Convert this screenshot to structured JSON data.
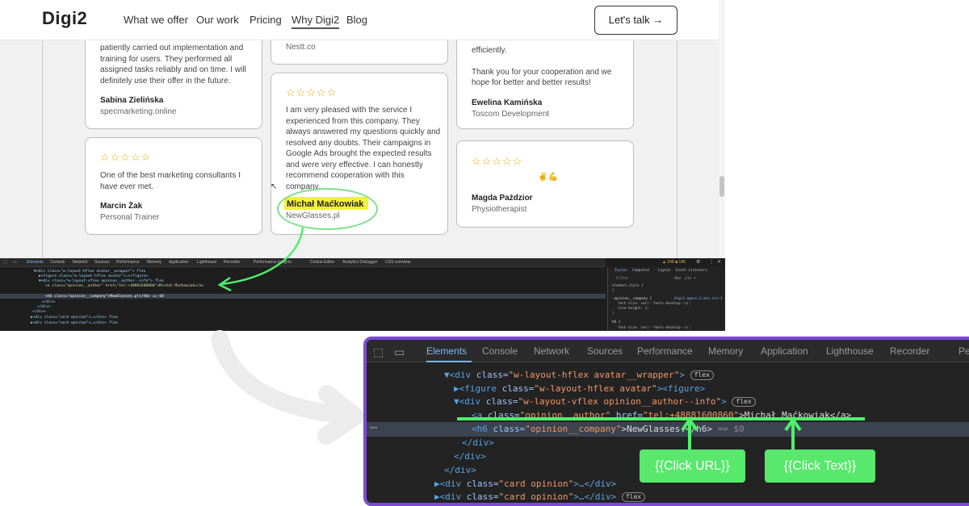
{
  "site": {
    "logo": "Digi2",
    "nav": [
      "What we offer",
      "Our work",
      "Pricing",
      "Why Digi2",
      "Blog"
    ],
    "cta": "Let's talk →"
  },
  "testimonials": [
    {
      "stars": "☆☆☆☆☆",
      "text_lines": [
        "patiently carried out implementation and",
        "training for users. They performed all",
        "assigned tasks reliably and on time. I will",
        "definitely use their offer in the future."
      ],
      "name": "Sabina Zielińska",
      "company": "specmarketing.online"
    },
    {
      "stars": "☆☆☆☆☆",
      "text_lines": [
        "One of the best marketing consultants I",
        "have ever met."
      ],
      "name": "Marcin Żak",
      "company": "Personal Trainer"
    },
    {
      "stars": "",
      "text_lines": [],
      "name": "",
      "company": "Nestt.co"
    },
    {
      "stars": "☆☆☆☆☆",
      "text_lines": [
        "I am very pleased with the service I",
        "experienced from this company. They",
        "always answered my questions quickly and",
        "resolved any doubts. Their campaigns in",
        "Google Ads brought the expected results",
        "and were very effective. I can honestly",
        "recommend cooperation with this",
        "company."
      ],
      "name": "Michał Maćkowiak",
      "company": "NewGlasses.pl"
    },
    {
      "stars": "",
      "text_lines": [
        "efficiently.",
        "",
        "Thank you for your cooperation and we",
        "hope for better and better results!"
      ],
      "name": "Ewelina Kamińska",
      "company": "Toscom Development"
    },
    {
      "stars": "☆☆☆☆☆",
      "text_lines": [
        "✌💪"
      ],
      "name": "Magda Paździor",
      "company": "Physiotherapist"
    }
  ],
  "devtools_small": {
    "tabs": [
      "Elements",
      "Console",
      "Network",
      "Sources",
      "Performance",
      "Memory",
      "Application",
      "Lighthouse",
      "Recorder",
      "Performance insights",
      "Cookie-Editor",
      "Analytics Debugger",
      "CSS overview"
    ],
    "lines": [
      "▼<div class=\"w-layout-hflex avatar__wrapper\"> flex",
      "▶<figure class=\"w-layout-hflex avatar\">…</figure>",
      "▼<div class=\"w-layout-vflex opinion__author--info\"> flex",
      "<a class=\"opinion__author\" href=\"tel:+48881600860\">Michał Maćkowiak</a>",
      "<h6 class=\"opinion__company\">NewGlasses.pl</h6> == $0",
      "</div>",
      "</div>",
      "</div>",
      "▶<div class=\"card opinion\">…</div> flex",
      "▶<div class=\"card opinion\">…</div> flex"
    ],
    "status": "▲ 248  ■ 146",
    "style_tabs": [
      "Styles",
      "Computed",
      "Layout",
      "Event Listeners"
    ],
    "filter": "Filter",
    "filter_tools": ":hov .cls +",
    "style_lines": [
      "element.style {",
      "}",
      ".opinion__company {",
      "font-size: var(--fonts-desktop--s);",
      "line-height: 1;",
      "}",
      "h6 {",
      "font-size: var(--fonts-desktop--s);"
    ],
    "css_link": "digi2-agenc…3.min.css:1"
  },
  "devtools_zoom": {
    "tabs": [
      "Elements",
      "Console",
      "Network",
      "Sources",
      "Performance",
      "Memory",
      "Application",
      "Lighthouse",
      "Recorder",
      "Pe"
    ],
    "line1_tag": "▼<div ",
    "line1_attr": "class=",
    "line1_val": "\"w-layout-hflex avatar__wrapper\"",
    "line1_close": ">",
    "line2_tag": "▶<figure ",
    "line2_val": "\"w-layout-hflex avatar\"",
    "line2_close": "><figure>",
    "line3_tag": "▼<div ",
    "line3_val": "\"w-layout-vflex opinion__author--info\"",
    "line4_a": "<a ",
    "line4_class_val": "\"opinion__author\"",
    "line4_href": " href=",
    "line4_href_val": "\"tel:+48881600860\"",
    "line4_text": ">Michał Maćkowiak</a>",
    "line5_h6": "<h6 ",
    "line5_val": "\"opinion__company\"",
    "line5_text": ">NewGlasses.</h6>",
    "line5_dollar": " == $0",
    "line6": "</div>",
    "line7": "</div>",
    "line8": "</div>",
    "line9_tag": "▶<div ",
    "line9_val": "\"card opinion\"",
    "line9_close": ">…</div>",
    "line10_val": "\"card opinion\"",
    "pill": "flex",
    "button_url": "{{Click URL}}",
    "button_text": "{{Click Text}}"
  },
  "colors": {
    "zoom_border": "#7c4bd4",
    "green": "#57e86c",
    "highlight": "#f4f03a"
  }
}
